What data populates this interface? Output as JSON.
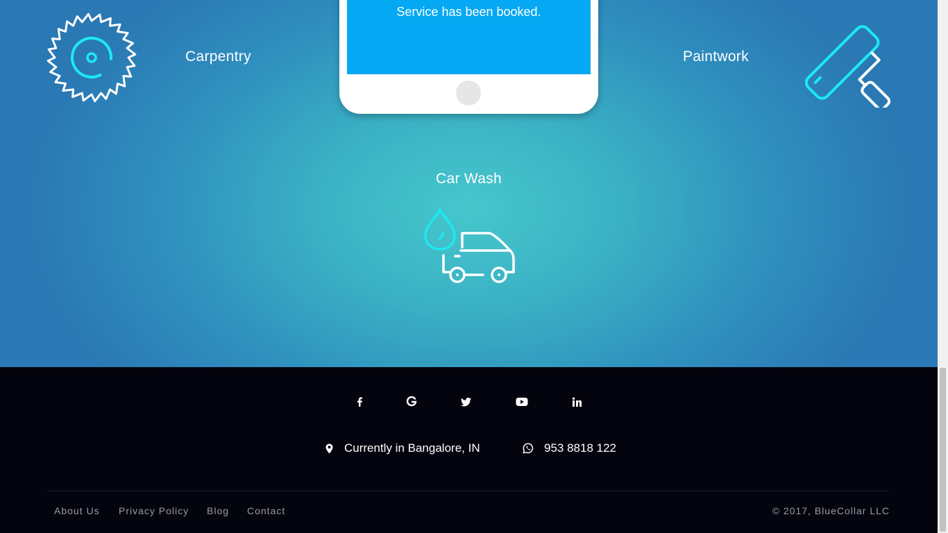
{
  "phone": {
    "message": "Service has been booked."
  },
  "services": [
    {
      "label": "Carpentry",
      "icon": "saw-blade-icon"
    },
    {
      "label": "Paintwork",
      "icon": "paint-roller-icon"
    },
    {
      "label": "Car Wash",
      "icon": "car-wash-icon"
    }
  ],
  "footer": {
    "social": [
      {
        "name": "facebook",
        "icon": "facebook-icon"
      },
      {
        "name": "google",
        "icon": "google-icon"
      },
      {
        "name": "twitter",
        "icon": "twitter-icon"
      },
      {
        "name": "youtube",
        "icon": "youtube-icon"
      },
      {
        "name": "linkedin",
        "icon": "linkedin-icon"
      }
    ],
    "location": "Currently in Bangalore, IN",
    "phone": "953 8818 122",
    "links": [
      "About Us",
      "Privacy Policy",
      "Blog",
      "Contact"
    ],
    "copyright": "© 2017, BlueCollar LLC"
  },
  "colors": {
    "accent_cyan": "#1de9f2",
    "phone_screen": "#05a8f2",
    "footer_bg": "#04040e",
    "footer_link": "#9b9ba6"
  }
}
